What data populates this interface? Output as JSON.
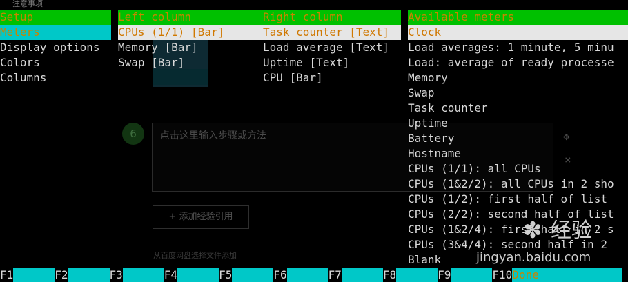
{
  "background": {
    "tab_text": "注意事项",
    "step_number": "6",
    "input_placeholder": "点击这里输入步骤或方法",
    "add_button": "+ 添加经验引用",
    "note": "从百度网盘选择文件添加"
  },
  "watermark": {
    "site": "jingyan.baidu.com",
    "brand_cn": "经验"
  },
  "setup": {
    "header": "Setup",
    "items": [
      "Meters",
      "Display options",
      "Colors",
      "Columns"
    ]
  },
  "left_column": {
    "header": "Left column",
    "items": [
      "CPUs (1/1) [Bar]",
      "Memory [Bar]",
      "Swap [Bar]"
    ]
  },
  "right_column": {
    "header": "Right column",
    "items": [
      "Task counter [Text]",
      "Load average [Text]",
      "Uptime [Text]",
      "CPU [Bar]"
    ]
  },
  "available_meters": {
    "header": "Available meters",
    "items": [
      "Clock",
      "Load averages: 1 minute, 5 minu",
      "Load: average of ready processe",
      "Memory",
      "Swap",
      "Task counter",
      "Uptime",
      "Battery",
      "Hostname",
      "CPUs (1/1): all CPUs",
      "CPUs (1&2/2): all CPUs in 2 sho",
      "CPUs (1/2): first half of list",
      "CPUs (2/2): second half of list",
      "CPUs (1&2/4): first half in 2 s",
      "CPUs (3&4/4): second half in 2",
      "Blank"
    ]
  },
  "footer": [
    {
      "key": "F1",
      "label": ""
    },
    {
      "key": "F2",
      "label": ""
    },
    {
      "key": "F3",
      "label": ""
    },
    {
      "key": "F4",
      "label": ""
    },
    {
      "key": "F5",
      "label": ""
    },
    {
      "key": "F6",
      "label": ""
    },
    {
      "key": "F7",
      "label": ""
    },
    {
      "key": "F8",
      "label": ""
    },
    {
      "key": "F9",
      "label": ""
    },
    {
      "key": "F10",
      "label": "Done"
    }
  ],
  "colors": {
    "header_bg": "#00c000",
    "header_fg": "#c88400",
    "selection_cyan": "#00c8c8",
    "selection_white": "#e6e6e6",
    "text": "#d8d8d8",
    "background": "#000000"
  }
}
